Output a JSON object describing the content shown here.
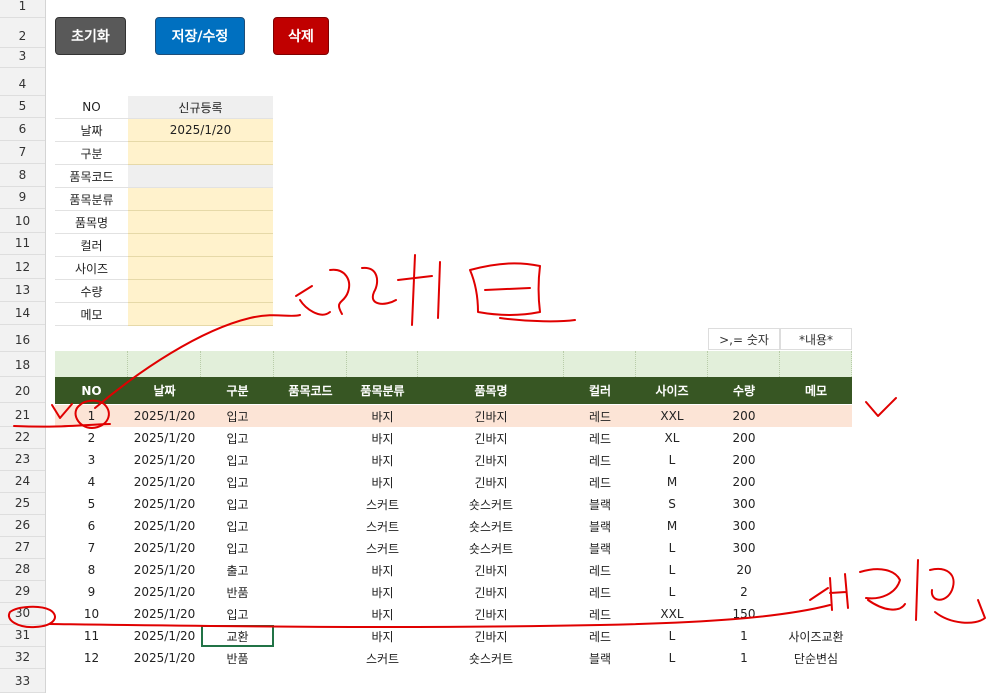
{
  "row_numbers": [
    "1",
    "2",
    "3",
    "4",
    "5",
    "6",
    "7",
    "8",
    "9",
    "10",
    "11",
    "12",
    "13",
    "14",
    "16",
    "18",
    "20",
    "21",
    "22",
    "23",
    "24",
    "25",
    "26",
    "27",
    "28",
    "29",
    "30",
    "31",
    "32",
    "33"
  ],
  "buttons": {
    "reset": {
      "label": "초기화",
      "color": "#595959"
    },
    "save": {
      "label": "저장/수정",
      "color": "#0070c0"
    },
    "delete": {
      "label": "삭제",
      "color": "#c00000"
    }
  },
  "form": {
    "rows": [
      {
        "label": "NO",
        "value": "신규등록"
      },
      {
        "label": "날짜",
        "value": "2025/1/20"
      },
      {
        "label": "구분",
        "value": ""
      },
      {
        "label": "품목코드",
        "value": ""
      },
      {
        "label": "품목분류",
        "value": ""
      },
      {
        "label": "품목명",
        "value": ""
      },
      {
        "label": "컬러",
        "value": ""
      },
      {
        "label": "사이즈",
        "value": ""
      },
      {
        "label": "수량",
        "value": ""
      },
      {
        "label": "메모",
        "value": ""
      }
    ]
  },
  "filter_notes": {
    "compare": ">,= 숫자",
    "content": "*내용*"
  },
  "table": {
    "header_color": "#375623",
    "columns": [
      "NO",
      "날짜",
      "구분",
      "품목코드",
      "품목분류",
      "품목명",
      "컬러",
      "사이즈",
      "수량",
      "메모"
    ],
    "rows": [
      [
        "1",
        "2025/1/20",
        "입고",
        "",
        "바지",
        "긴바지",
        "레드",
        "XXL",
        "200",
        ""
      ],
      [
        "2",
        "2025/1/20",
        "입고",
        "",
        "바지",
        "긴바지",
        "레드",
        "XL",
        "200",
        ""
      ],
      [
        "3",
        "2025/1/20",
        "입고",
        "",
        "바지",
        "긴바지",
        "레드",
        "L",
        "200",
        ""
      ],
      [
        "4",
        "2025/1/20",
        "입고",
        "",
        "바지",
        "긴바지",
        "레드",
        "M",
        "200",
        ""
      ],
      [
        "5",
        "2025/1/20",
        "입고",
        "",
        "스커트",
        "숏스커트",
        "블랙",
        "S",
        "300",
        ""
      ],
      [
        "6",
        "2025/1/20",
        "입고",
        "",
        "스커트",
        "숏스커트",
        "블랙",
        "M",
        "300",
        ""
      ],
      [
        "7",
        "2025/1/20",
        "입고",
        "",
        "스커트",
        "숏스커트",
        "블랙",
        "L",
        "300",
        ""
      ],
      [
        "8",
        "2025/1/20",
        "출고",
        "",
        "바지",
        "긴바지",
        "레드",
        "L",
        "20",
        ""
      ],
      [
        "9",
        "2025/1/20",
        "반품",
        "",
        "바지",
        "긴바지",
        "레드",
        "L",
        "2",
        ""
      ],
      [
        "10",
        "2025/1/20",
        "입고",
        "",
        "바지",
        "긴바지",
        "레드",
        "XXL",
        "150",
        ""
      ],
      [
        "11",
        "2025/1/20",
        "교환",
        "",
        "바지",
        "긴바지",
        "레드",
        "L",
        "1",
        "사이즈교환"
      ],
      [
        "12",
        "2025/1/20",
        "반품",
        "",
        "스커트",
        "숏스커트",
        "블랙",
        "L",
        "1",
        "단순변심"
      ]
    ]
  },
  "annotations": {
    "edit_note": "수정하면",
    "changed_note": "변경됨"
  }
}
